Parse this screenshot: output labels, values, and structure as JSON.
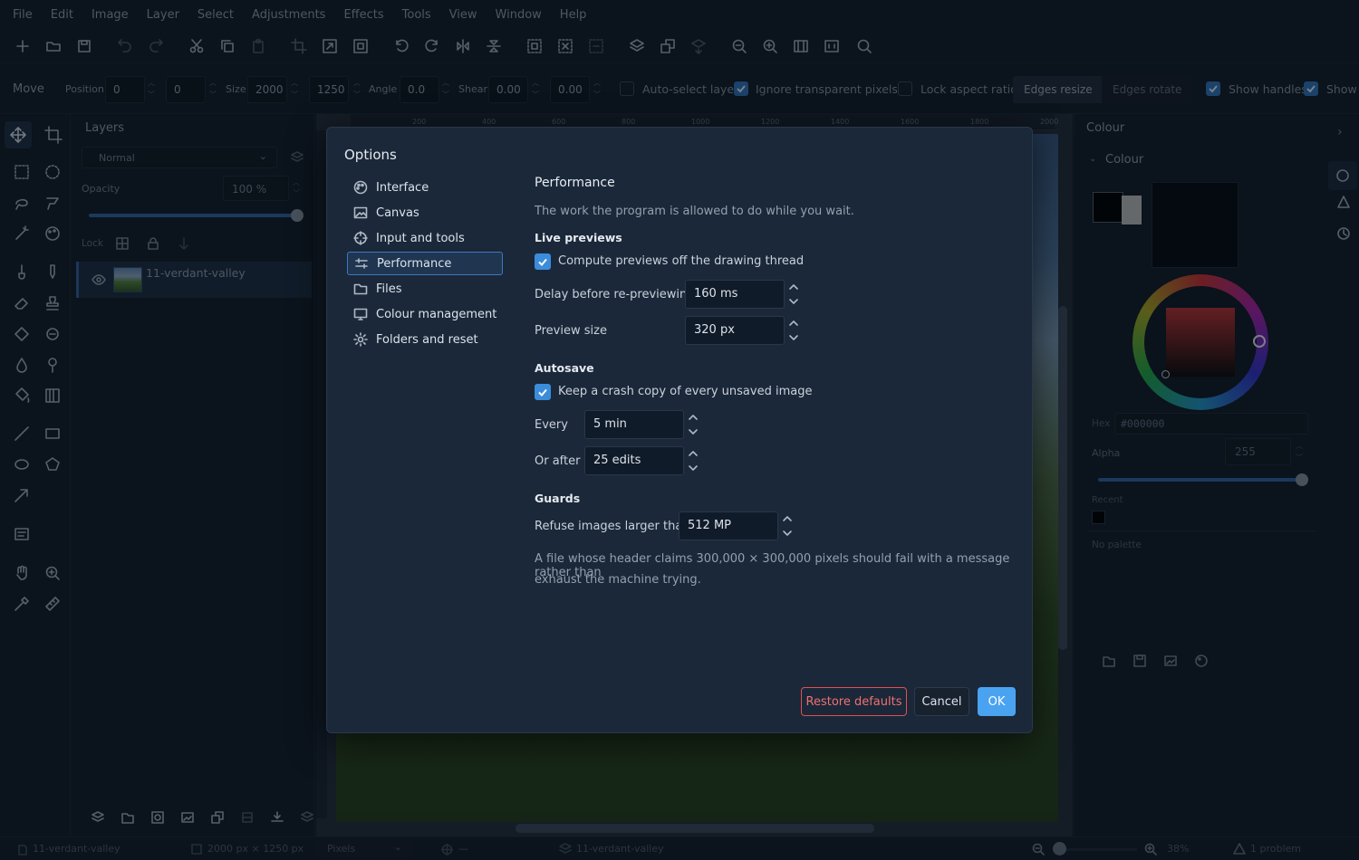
{
  "menu": [
    "File",
    "Edit",
    "Image",
    "Layer",
    "Select",
    "Adjustments",
    "Effects",
    "Tools",
    "View",
    "Window",
    "Help"
  ],
  "options_bar": {
    "tool_name": "Move",
    "position_label": "Position",
    "position_x": "0",
    "position_y": "0",
    "size_label": "Size",
    "size_w": "2000",
    "size_h": "1250",
    "angle_label": "Angle",
    "angle": "0.0",
    "shear_label": "Shear",
    "shear_x": "0.00",
    "shear_y": "0.00",
    "auto_select": "Auto-select layer",
    "ignore_transparent": "Ignore transparent pixels",
    "lock_aspect": "Lock aspect ratio",
    "edges_resize": "Edges resize",
    "edges_rotate": "Edges rotate",
    "show_handles": "Show handles",
    "show_more": "Show"
  },
  "layers": {
    "title": "Layers",
    "blend_mode": "Normal",
    "opacity_label": "Opacity",
    "opacity": "100 %",
    "opacity_fraction": 1.0,
    "lock_label": "Lock",
    "items": [
      {
        "name": "11-verdant-valley"
      }
    ]
  },
  "ruler_ticks": [
    "200",
    "400",
    "600",
    "800",
    "1000",
    "1200",
    "1400",
    "1600",
    "1800",
    "2000"
  ],
  "colour_panel": {
    "tab": "Colour",
    "section": "Colour",
    "hex_label": "Hex",
    "hex_value": "#000000",
    "alpha_label": "Alpha",
    "alpha_value": "255",
    "recent_label": "Recent",
    "palette_text": "No palette",
    "primary": "#000000",
    "secondary": "#b4b4b4"
  },
  "status": {
    "file": "11-verdant-valley",
    "dimensions": "2000 px × 1250 px",
    "unit": "Pixels",
    "cursor": "—",
    "layer": "11-verdant-valley",
    "zoom": "38%",
    "problems": "1 problem"
  },
  "dialog": {
    "title": "Options",
    "nav": [
      {
        "label": "Interface",
        "icon": "palette-icon"
      },
      {
        "label": "Canvas",
        "icon": "image-icon"
      },
      {
        "label": "Input and tools",
        "icon": "crosshair-icon"
      },
      {
        "label": "Performance",
        "icon": "sliders-icon",
        "selected": true
      },
      {
        "label": "Files",
        "icon": "folder-icon"
      },
      {
        "label": "Colour management",
        "icon": "monitor-icon"
      },
      {
        "label": "Folders and reset",
        "icon": "gear-icon"
      }
    ],
    "page_title": "Performance",
    "page_desc": "The work the program is allowed to do while you wait.",
    "live_previews": {
      "heading": "Live previews",
      "compute_off_thread": "Compute previews off the drawing thread",
      "compute_checked": true,
      "delay_label": "Delay before re-previewing",
      "delay_value": "160  ms",
      "size_label": "Preview size",
      "size_value": "320  px"
    },
    "autosave": {
      "heading": "Autosave",
      "crash_copy": "Keep a crash copy of every unsaved image",
      "crash_checked": true,
      "every_label": "Every",
      "every_value": "5  min",
      "after_label": "Or after",
      "after_value": "25  edits"
    },
    "guards": {
      "heading": "Guards",
      "refuse_label": "Refuse images larger than",
      "refuse_value": "512  MP",
      "note_line1": "A file whose header claims 300,000 × 300,000 pixels should fail with a message rather than",
      "note_line2": "exhaust the machine trying."
    },
    "buttons": {
      "restore": "Restore defaults",
      "cancel": "Cancel",
      "ok": "OK"
    }
  }
}
